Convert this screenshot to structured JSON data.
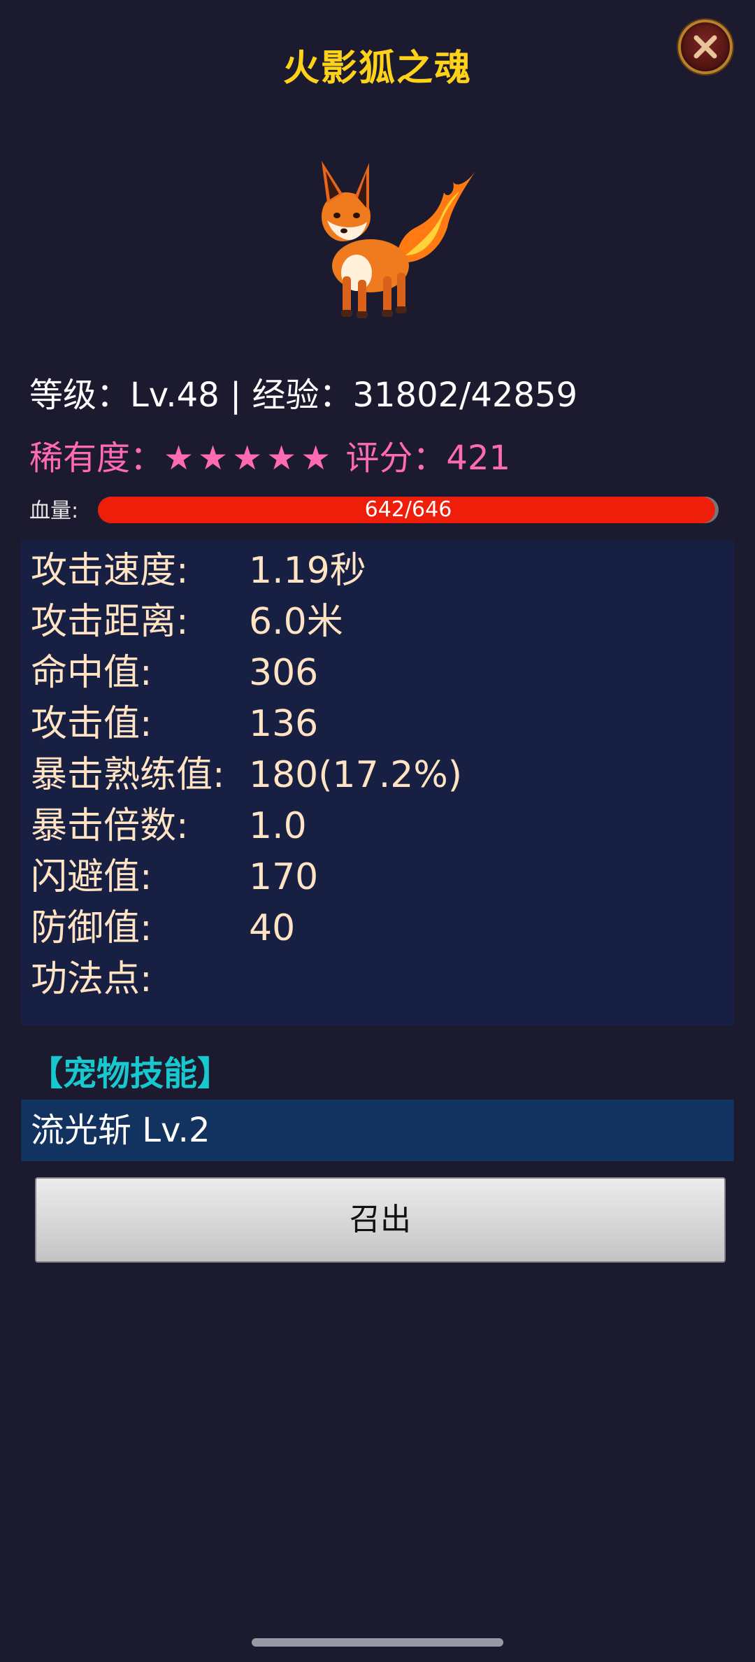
{
  "pet": {
    "name": "火影狐之魂",
    "level_line": "等级：Lv.48 | 经验：31802/42859",
    "rarity_label": "稀有度：",
    "rarity_stars": "★★★★★",
    "rarity_score": " 评分：421",
    "hp_label": "血量:",
    "hp_text": "642/646",
    "hp_fraction": 0.994
  },
  "stats": [
    {
      "key": "攻击速度:",
      "value": "1.19秒"
    },
    {
      "key": "攻击距离:",
      "value": "6.0米"
    },
    {
      "key": "命中值:",
      "value": "306"
    },
    {
      "key": "攻击值:",
      "value": "136"
    },
    {
      "key": "暴击熟练值:",
      "value": "180(17.2%)"
    },
    {
      "key": "暴击倍数:",
      "value": "1.0"
    },
    {
      "key": "闪避值:",
      "value": "170"
    },
    {
      "key": "防御值:",
      "value": "40"
    },
    {
      "key": "功法点:",
      "value": ""
    }
  ],
  "skills": {
    "header": "【宠物技能】",
    "items": [
      "流光斩 Lv.2"
    ]
  },
  "actions": {
    "summon_label": "召出"
  },
  "icons": {
    "close": "close-icon",
    "pet": "fire-fox-icon"
  },
  "colors": {
    "background": "#1b1a2e",
    "title": "#ffd21a",
    "rarity": "#ff6ab4",
    "hp_fill": "#ee1e0a",
    "stat_text": "#ffe3c2",
    "skill_header": "#18c8cf"
  }
}
